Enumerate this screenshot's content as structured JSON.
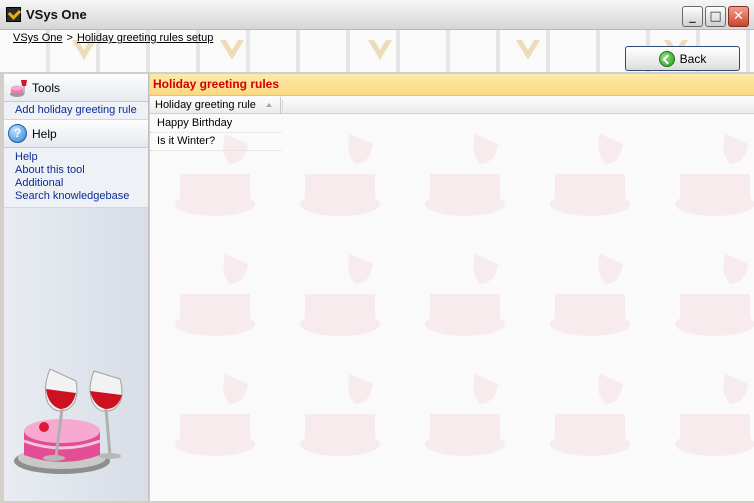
{
  "window": {
    "title": "VSys One",
    "minimize_glyph": "_",
    "maximize_glyph": "□",
    "close_glyph": "✕"
  },
  "breadcrumb": {
    "root": "VSys One",
    "separator": ">",
    "current": "Holiday greeting rules setup"
  },
  "toolbar": {
    "back_label": "Back"
  },
  "sidebar": {
    "tools": {
      "title": "Tools",
      "links": [
        "Add holiday greeting rule"
      ]
    },
    "help": {
      "title": "Help",
      "links": [
        "Help",
        "About this tool",
        "Additional",
        "Search knowledgebase"
      ]
    }
  },
  "panel": {
    "title": "Holiday greeting rules",
    "column_header": "Holiday greeting rule",
    "rows": [
      "Happy Birthday",
      "Is it Winter?"
    ]
  },
  "colors": {
    "panel_title": "#d40000",
    "panel_header_bg": "#fbd982",
    "link": "#0c2b9a",
    "back_icon": "#2d9a22",
    "help_icon": "#2f7fd0"
  },
  "icons": {
    "app": "vsys-logo-icon",
    "tools": "cake-glasses-icon",
    "help": "question-icon",
    "back": "back-arrow-icon",
    "sort": "sort-ascending-icon"
  }
}
